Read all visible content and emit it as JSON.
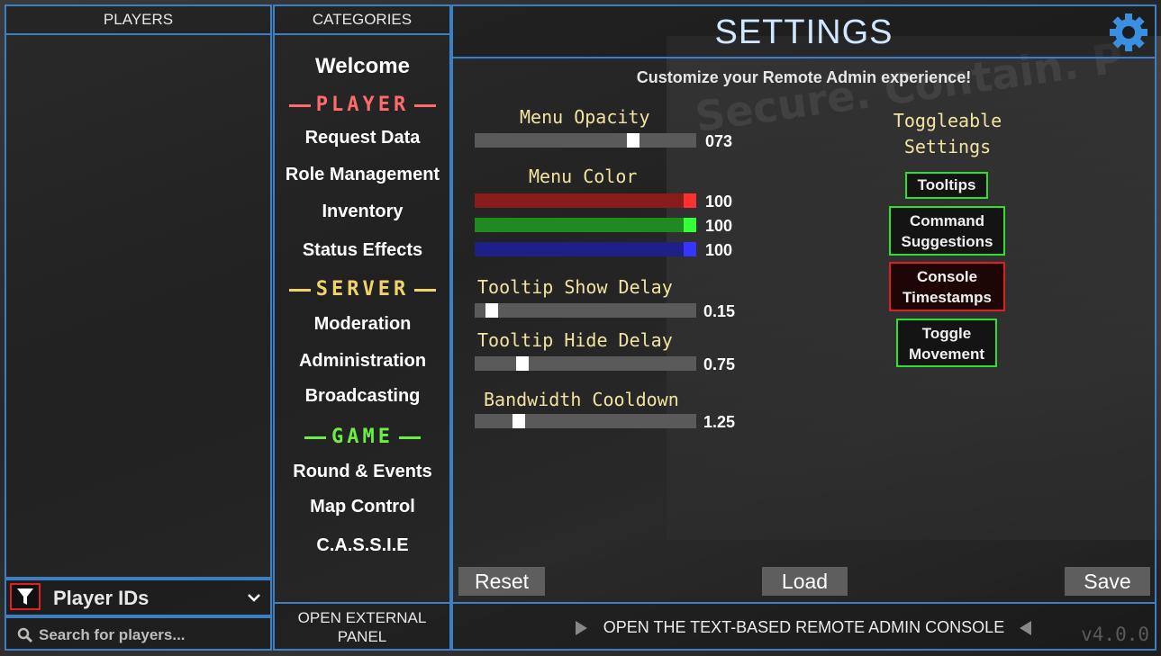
{
  "colors": {
    "accent": "#3b7fc4",
    "player": "#ff6b6b",
    "server": "#f2d36b",
    "game": "#6bef45",
    "toggle_on": "#2ee02e",
    "toggle_off": "#e02020"
  },
  "players_panel": {
    "header": "PLAYERS",
    "filter_label": "Player IDs",
    "filter_icon": "filter-icon",
    "search_placeholder": "Search for players..."
  },
  "categories": {
    "header": "CATEGORIES",
    "welcome": "Welcome",
    "player_section": "PLAYER",
    "player_items": [
      "Request Data",
      "Role Management",
      "Inventory",
      "Status Effects"
    ],
    "server_section": "SERVER",
    "server_items": [
      "Moderation",
      "Administration",
      "Broadcasting"
    ],
    "game_section": "GAME",
    "game_items": [
      "Round & Events",
      "Map Control",
      "C.A.S.S.I.E"
    ],
    "external_panel": "OPEN EXTERNAL PANEL"
  },
  "settings": {
    "title": "SETTINGS",
    "subtitle": "Customize your Remote Admin experience!",
    "menu_opacity": {
      "label": "Menu Opacity",
      "value": "073",
      "fraction": 0.73
    },
    "menu_color": {
      "label": "Menu Color",
      "r": "100",
      "g": "100",
      "b": "100",
      "r_fraction": 1.0,
      "g_fraction": 1.0,
      "b_fraction": 1.0
    },
    "tooltip_show": {
      "label": "Tooltip Show Delay",
      "value": "0.15",
      "fraction": 0.05
    },
    "tooltip_hide": {
      "label": "Tooltip Hide Delay",
      "value": "0.75",
      "fraction": 0.2
    },
    "bandwidth": {
      "label": "Bandwidth Cooldown",
      "value": "1.25",
      "fraction": 0.18
    },
    "toggles_title": "Toggleable Settings",
    "toggles": [
      {
        "label": "Tooltips",
        "state": "on"
      },
      {
        "label": "Command Suggestions",
        "state": "on"
      },
      {
        "label": "Console Timestamps",
        "state": "off"
      },
      {
        "label": "Toggle Movement",
        "state": "on"
      }
    ],
    "reset": "Reset",
    "load": "Load",
    "save": "Save"
  },
  "console_bar": "OPEN THE TEXT-BASED REMOTE ADMIN CONSOLE",
  "version": "v4.0.0",
  "background_text": "Secure. Contain. P"
}
